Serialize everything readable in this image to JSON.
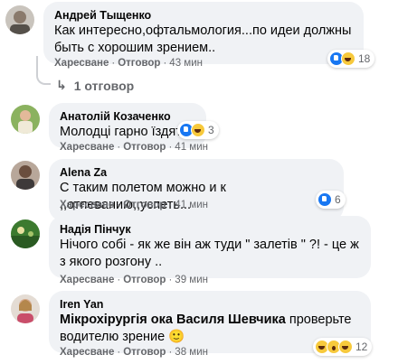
{
  "common": {
    "like_label": "Харесване",
    "reply_label": "Отговор",
    "separator": "·"
  },
  "comments": [
    {
      "author": "Андрей Тыщенко",
      "text": "Как интересно,офтальмология...по идеи должны быть с хорошим зрением..",
      "time": "43 мин",
      "reactions": [
        "like",
        "haha"
      ],
      "reaction_count": "18"
    },
    {
      "author": "Анатолій Козаченко",
      "text": "Молодці гарно їздять",
      "time": "41 мин",
      "reactions": [
        "like",
        "haha"
      ],
      "reaction_count": "3"
    },
    {
      "author": "Alena Za",
      "text": "С таким полетом можно и к ,,отпеванию,,успеть...",
      "time": "41 мин",
      "reactions": [
        "like"
      ],
      "reaction_count": "6"
    },
    {
      "author": "Надія Пінчук",
      "text": "Нічого собі - як же він аж туди \" залетів \" ?! - це ж з якого розгону ..",
      "time": "39 мин"
    },
    {
      "author": "Iren Yan",
      "text_bold": "Мікрохірургія ока Василя Шевчика",
      "text_rest": " проверьте водителю зрение 🙂",
      "time": "38 мин",
      "reactions": [
        "haha",
        "wow",
        "haha"
      ],
      "reaction_count": "12"
    }
  ],
  "replies_link": "1 отговор",
  "colors": {
    "bubble": "#f0f2f5",
    "meta": "#65676b",
    "like": "#1877f2",
    "haha": "#f7c93c"
  }
}
